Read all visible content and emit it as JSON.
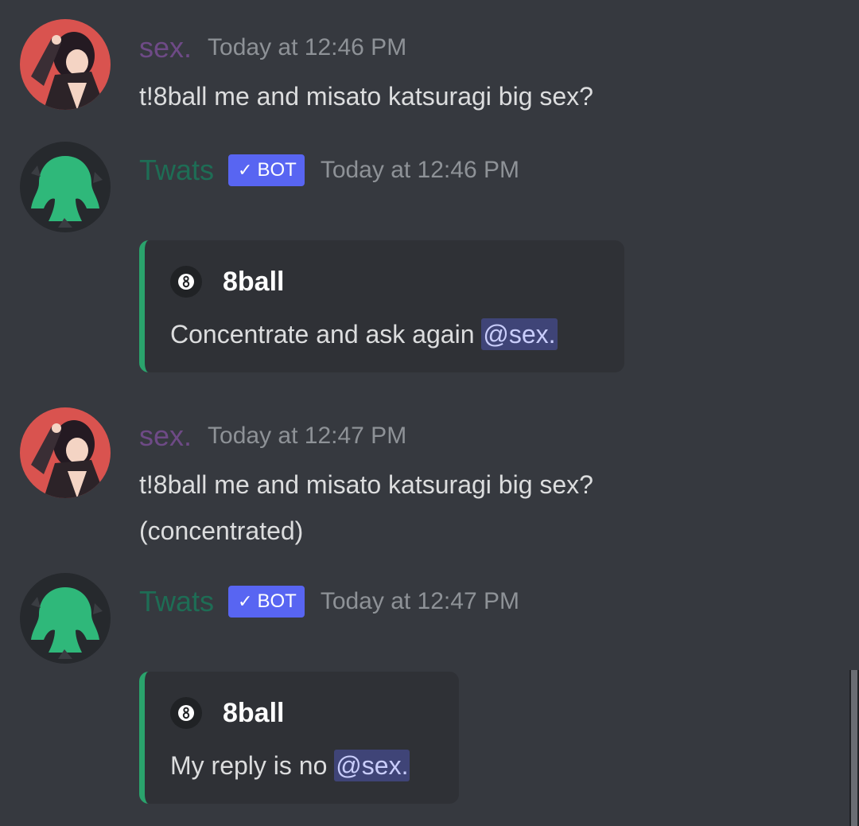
{
  "messages": [
    {
      "author": "sex.",
      "timestamp": "Today at 12:46 PM",
      "lines": [
        "t!8ball me and misato katsuragi big sex?"
      ]
    },
    {
      "author": "Twats",
      "bot_tag": "BOT",
      "timestamp": "Today at 12:46 PM",
      "embed": {
        "author_name": "8ball",
        "icon_glyph": "8",
        "description": "Concentrate and ask again",
        "mention": "@sex."
      }
    },
    {
      "author": "sex.",
      "timestamp": "Today at 12:47 PM",
      "lines": [
        "t!8ball me and misato katsuragi big sex?",
        "(concentrated)"
      ]
    },
    {
      "author": "Twats",
      "bot_tag": "BOT",
      "timestamp": "Today at 12:47 PM",
      "embed": {
        "author_name": "8ball",
        "icon_glyph": "8",
        "description": "My reply is no",
        "mention": "@sex."
      }
    }
  ],
  "colors": {
    "background": "#36393f",
    "user_name": "#6e4a86",
    "bot_name": "#1e6d55",
    "bot_tag": "#5865f2",
    "embed_bg": "#2f3136",
    "embed_border": "#2aa36c",
    "mention_bg": "#3f4477"
  },
  "icons": {
    "user_avatar": "anime-character-avatar",
    "bot_avatar": "green-silhouette-avatar",
    "bot_check": "checkmark-icon",
    "embed_icon": "eight-ball-icon"
  }
}
